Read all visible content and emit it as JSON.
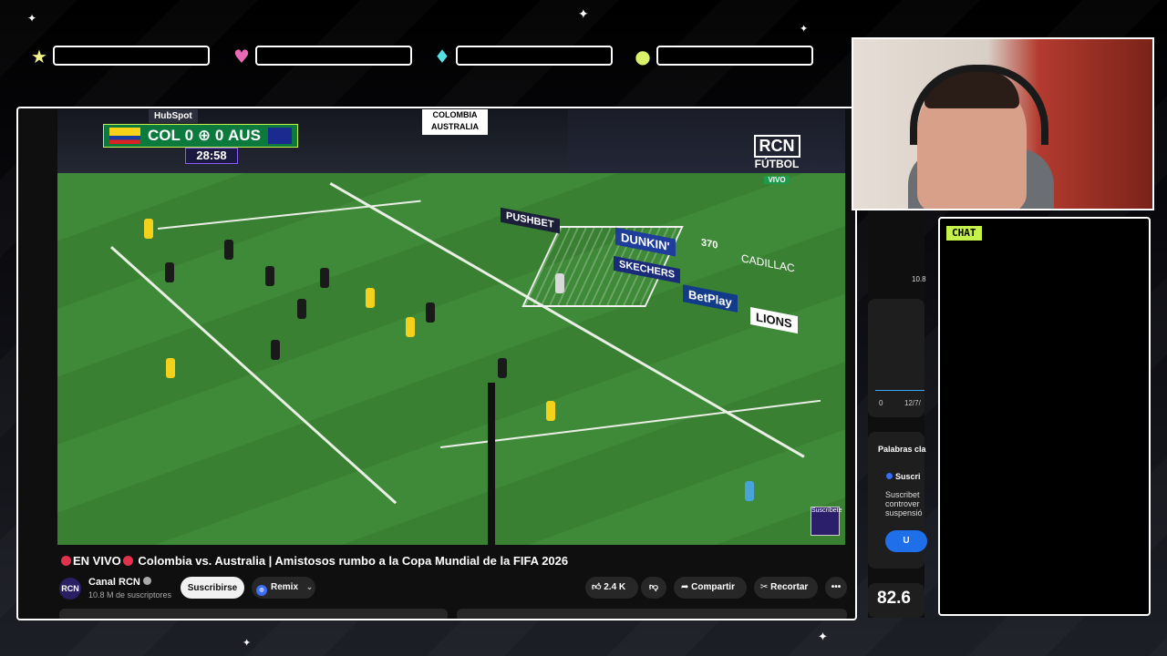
{
  "overlay": {
    "hud_icons": [
      "star-icon",
      "heart-icon",
      "diamond-icon",
      "coin-icon"
    ],
    "colors": {
      "star": "#f2f28a",
      "heart": "#e86ab4",
      "diamond": "#55e0e6",
      "coin": "#d9f06a",
      "accent": "#c6f04a"
    },
    "chat_label": "CHAT"
  },
  "video": {
    "scorebug": {
      "home": "COL",
      "home_score": "0",
      "away_score": "0",
      "away": "AUS",
      "clock": "28:58"
    },
    "sponsor": "HubSpot",
    "top_banner": "COLOMBIA AUSTRALIA",
    "channel_logo": {
      "mark": "RCN",
      "name": "FÚTBOL",
      "sub": "VIVO"
    },
    "boards": [
      "DUNKIN'",
      "BetPlay",
      "LIONS",
      "SKECHERS",
      "CADILLAC",
      "PUSHBET",
      "370"
    ],
    "corner_badge": "Suscríbete"
  },
  "page": {
    "title_live": "EN VIVO",
    "title": "Colombia vs. Australia | Amistosos rumbo a la Copa Mundial de la FIFA 2026",
    "channel_name": "Canal RCN",
    "subscribers": "10.8 M de suscriptores",
    "subscribe_label": "Suscribirse",
    "remix_label": "Remix",
    "likes": "2.4 K",
    "share_label": "Compartir",
    "clip_label": "Recortar"
  },
  "side": {
    "subs_short": "10.8",
    "chart_x0": "0",
    "chart_date": "12/7/",
    "keywords_label": "Palabras cla",
    "keyword_title": "Suscri",
    "keyword_text": [
      "Suscribet",
      "controver",
      "suspensió"
    ],
    "cta": "U",
    "score": "82.6"
  }
}
